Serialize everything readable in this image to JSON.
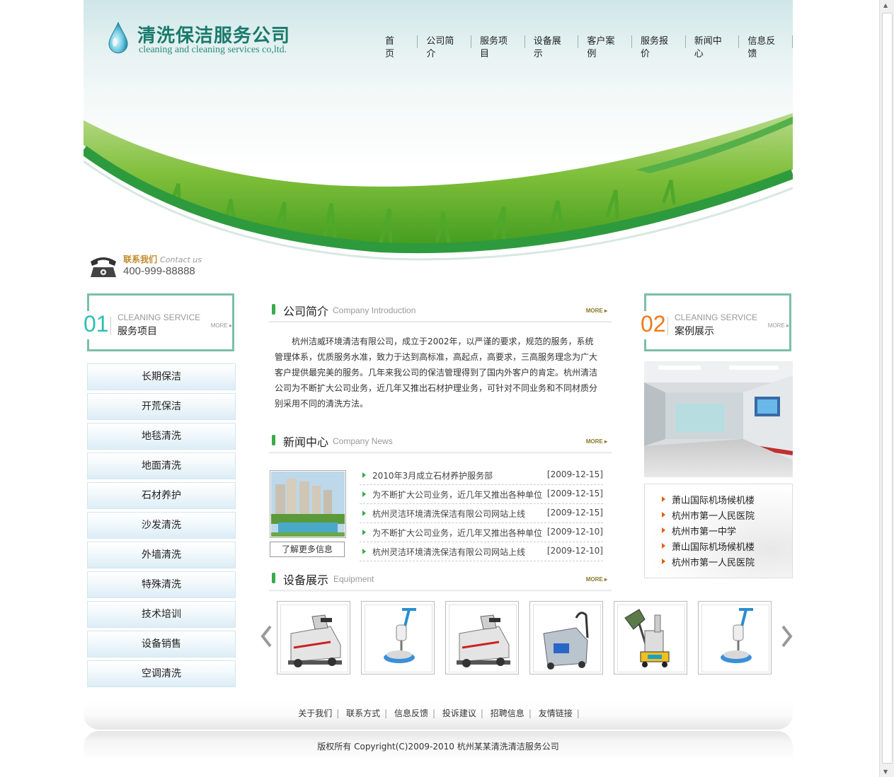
{
  "header": {
    "logo_cn": "清洗保洁服务公司",
    "logo_en": "cleaning and cleaning services co,ltd.",
    "nav": [
      "首页",
      "公司简介",
      "服务项目",
      "设备展示",
      "客户案例",
      "服务报价",
      "新闻中心",
      "信息反馈"
    ],
    "contact_label": "联系我们",
    "contact_label_en": "Contact us",
    "phone": "400-999-88888"
  },
  "left": {
    "num": "01",
    "en": "CLEANING SERVICE",
    "cn": "服务项目",
    "more": "MORE",
    "services": [
      "长期保洁",
      "开荒保洁",
      "地毯清洗",
      "地面清洗",
      "石材养护",
      "沙发清洗",
      "外墙清洗",
      "特殊清洗",
      "技术培训",
      "设备销售",
      "空调清洗"
    ]
  },
  "intro": {
    "title": "公司简介",
    "title_en": "Company Introduction",
    "more": "MORE",
    "text": "杭州洁威环境清洁有限公司，成立于2002年，以严谨的要求，规范的服务，系统管理体系，优质服务水准，致力于达到高标准，高起点，高要求，三高服务理念为广大客户提供最完美的服务。几年来我公司的保洁管理得到了国内外客户的肯定。杭州清洁公司为不断扩大公司业务，近几年又推出石材护理业务，可针对不同业务和不同材质分别采用不同的清洗方法。"
  },
  "news": {
    "title": "新闻中心",
    "title_en": "Company News",
    "more": "MORE",
    "more_btn": "了解更多信息",
    "items": [
      {
        "title": "2010年3月成立石材养护服务部",
        "date": "[2009-12-15]"
      },
      {
        "title": "为不断扩大公司业务，近几年又推出各种单位",
        "date": "[2009-12-15]"
      },
      {
        "title": "杭州灵洁环境清洗保洁有限公司网站上线",
        "date": "[2009-12-15]"
      },
      {
        "title": "为不断扩大公司业务，近几年又推出各种单位",
        "date": "[2009-12-10]"
      },
      {
        "title": "杭州灵洁环境清洗保洁有限公司网站上线",
        "date": "[2009-12-10]"
      }
    ]
  },
  "equipment": {
    "title": "设备展示",
    "title_en": "Equipment",
    "more": "MORE",
    "items": [
      "scrubber-machine",
      "floor-polisher",
      "scrubber-machine",
      "carpet-extractor",
      "wall-cleaner",
      "floor-polisher"
    ]
  },
  "right": {
    "num": "02",
    "en": "CLEANING SERVICE",
    "cn": "案例展示",
    "more": "MORE",
    "cases": [
      "萧山国际机场候机楼",
      "杭州市第一人民医院",
      "杭州市第一中学",
      "萧山国际机场候机楼",
      "杭州市第一人民医院"
    ]
  },
  "footer": {
    "links": [
      "关于我们",
      "联系方式",
      "信息反馈",
      "投诉建议",
      "招聘信息",
      "友情链接"
    ],
    "separator": "|",
    "copyright": "版权所有  Copyright(C)2009-2010 杭州某某清洗清洁服务公司"
  },
  "colors": {
    "accent_green": "#3aaa4a",
    "num_01": "#2ec0b0",
    "num_02": "#f07a1a"
  }
}
